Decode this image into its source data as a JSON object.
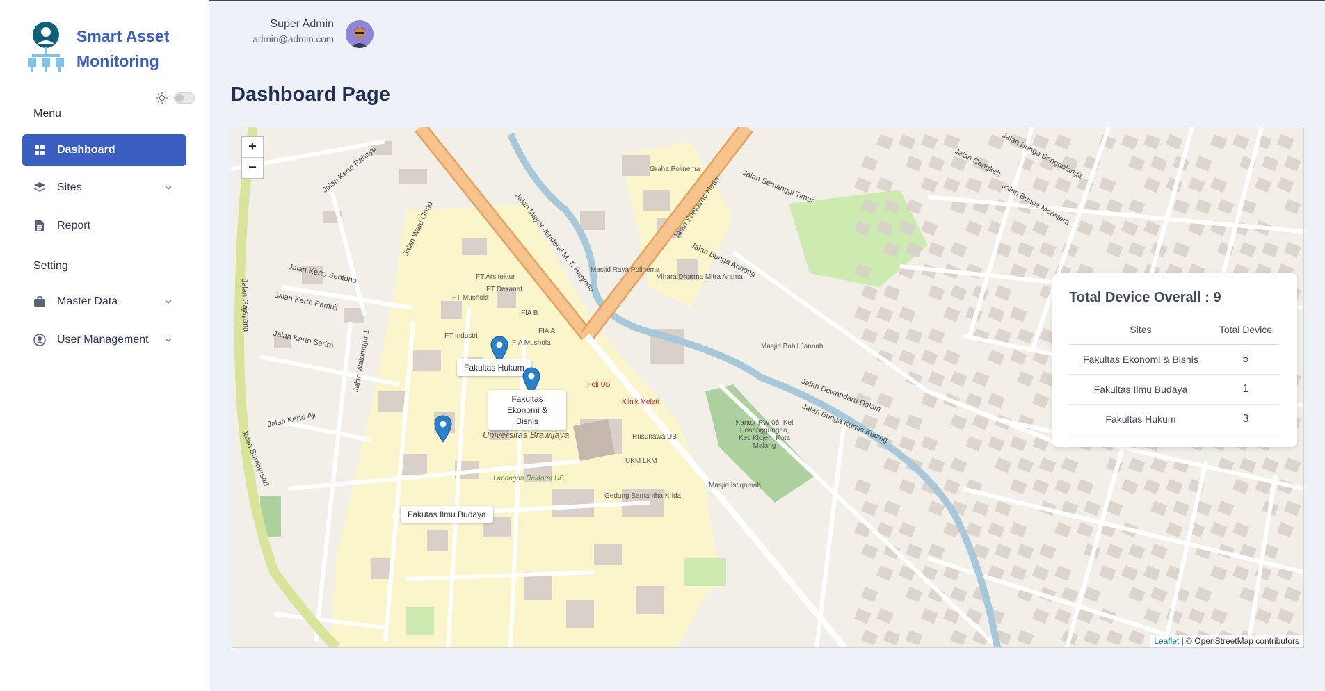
{
  "app": {
    "brand_line1": "Smart Asset",
    "brand_line2": "Monitoring"
  },
  "sidebar": {
    "menu_label": "Menu",
    "setting_label": "Setting",
    "items": [
      {
        "label": "Dashboard",
        "icon": "grid-icon",
        "active": true
      },
      {
        "label": "Sites",
        "icon": "layers-icon",
        "has_submenu": true
      },
      {
        "label": "Report",
        "icon": "document-icon"
      },
      {
        "label": "Master Data",
        "icon": "briefcase-icon",
        "has_submenu": true
      },
      {
        "label": "User Management",
        "icon": "user-circle-icon",
        "has_submenu": true
      }
    ]
  },
  "header": {
    "user_name": "Super Admin",
    "user_email": "admin@admin.com"
  },
  "page": {
    "title": "Dashboard Page"
  },
  "map": {
    "zoom_in": "+",
    "zoom_out": "−",
    "attribution_leaflet": "Leaflet",
    "attribution_rest": " | © OpenStreetMap contributors",
    "markers": [
      {
        "label": "Fakultas Hukum"
      },
      {
        "label": "Fakultas Ekonomi & Bisnis"
      },
      {
        "label": "Fakutas Ilmu Budaya"
      }
    ],
    "streets": [
      "Jalan Mayor Jenderal M. T. Haryono",
      "Jalan Soekarno Hatta",
      "Jalan Kerto Rahayu",
      "Jalan Watu Gong",
      "Jalan Kerto Sentono",
      "Jalan Kerto Pamuji",
      "Jalan Kerto Sariro",
      "Jalan Gajayana",
      "Jalan Sumbersari",
      "Jalan Semanggi Timur",
      "Jalan Bunga Andong",
      "Jalan Dewandaru Dalam",
      "Jalan Bunga Kumis Kucing",
      "Jalan Cengkeh",
      "Jalan Bunga Songgolangit",
      "Jalan Bunga Monstera",
      "Jalan Watumujur 1",
      "Jalan Kerto Aji"
    ],
    "places": [
      "Universitas Brawijaya",
      "FT Mushola",
      "FIA Mushola",
      "Poli UB",
      "Klinik Melati",
      "Masjid Raya Polinema",
      "Vihara Dharma Mitra Arama",
      "Graha Polinema",
      "FT Industri",
      "FT Arsitektur",
      "FT Dekanat",
      "FIA B",
      "FIA A",
      "Gedung Samantha Krida",
      "Masjid Istiqomah",
      "Masjid Babil Jannah",
      "Kantor RW 05, Kel Penanggungan, Kec Klojen, Kota Malang",
      "Lapangan Rektorat UB",
      "Rusunawa UB",
      "UKM LKM"
    ]
  },
  "device_card": {
    "title": "Total Device Overall : 9",
    "col_sites": "Sites",
    "col_total": "Total Device",
    "rows": [
      {
        "site": "Fakultas Ekonomi & Bisnis",
        "total": "5"
      },
      {
        "site": "Fakultas Ilmu Budaya",
        "total": "1"
      },
      {
        "site": "Fakultas Hukum",
        "total": "3"
      }
    ]
  },
  "colors": {
    "accent": "#3b5fc0",
    "background": "#eef2f8",
    "title": "#233056",
    "major_road": "#f5c38b",
    "campus": "#fbf5cc",
    "river": "#a7c8d8",
    "marker": "#2a81cb"
  }
}
